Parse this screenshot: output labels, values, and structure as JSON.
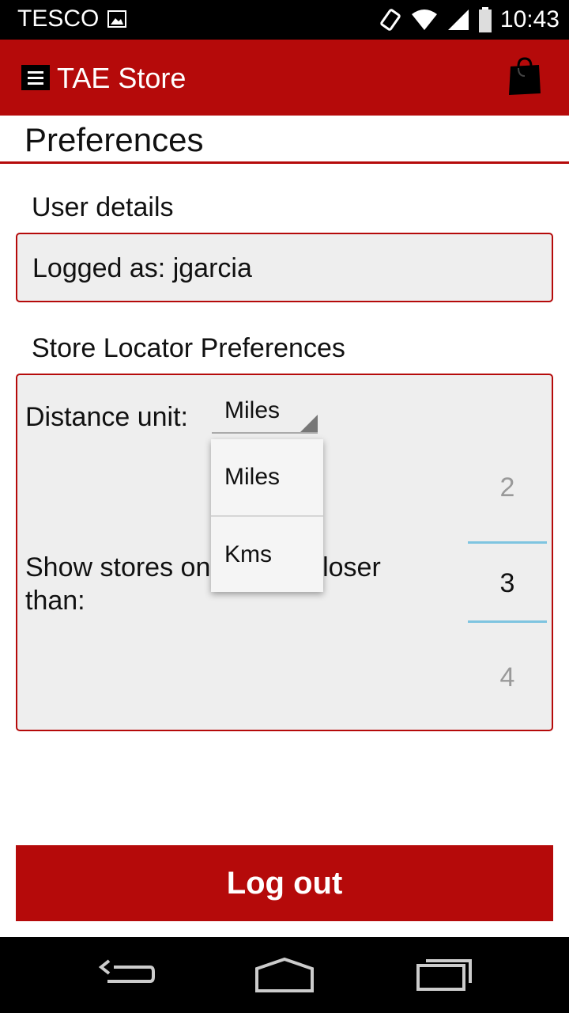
{
  "status_bar": {
    "carrier": "TESCO",
    "time": "10:43",
    "icons": [
      "image-icon",
      "vibrate-icon",
      "wifi-icon",
      "signal-icon",
      "battery-icon"
    ]
  },
  "app_bar": {
    "title": "TAE Store",
    "menu_icon": "hamburger-menu-icon",
    "cart_icon": "shopping-bag-icon",
    "color": "#b50a0a"
  },
  "page": {
    "title": "Preferences"
  },
  "user_details": {
    "section_label": "User details",
    "logged_as": "Logged as: jgarcia"
  },
  "store_locator": {
    "section_label": "Store Locator Preferences",
    "distance_unit_label": "Distance unit:",
    "distance_unit_value": "Miles",
    "dropdown_options": [
      "Miles",
      "Kms"
    ],
    "show_stores_label": "Show stores only when closer than:",
    "number_picker": {
      "prev": "2",
      "current": "3",
      "next": "4"
    }
  },
  "logout_button": {
    "label": "Log out"
  },
  "nav_bar": {
    "icons": [
      "back-icon",
      "home-icon",
      "recent-apps-icon"
    ]
  }
}
